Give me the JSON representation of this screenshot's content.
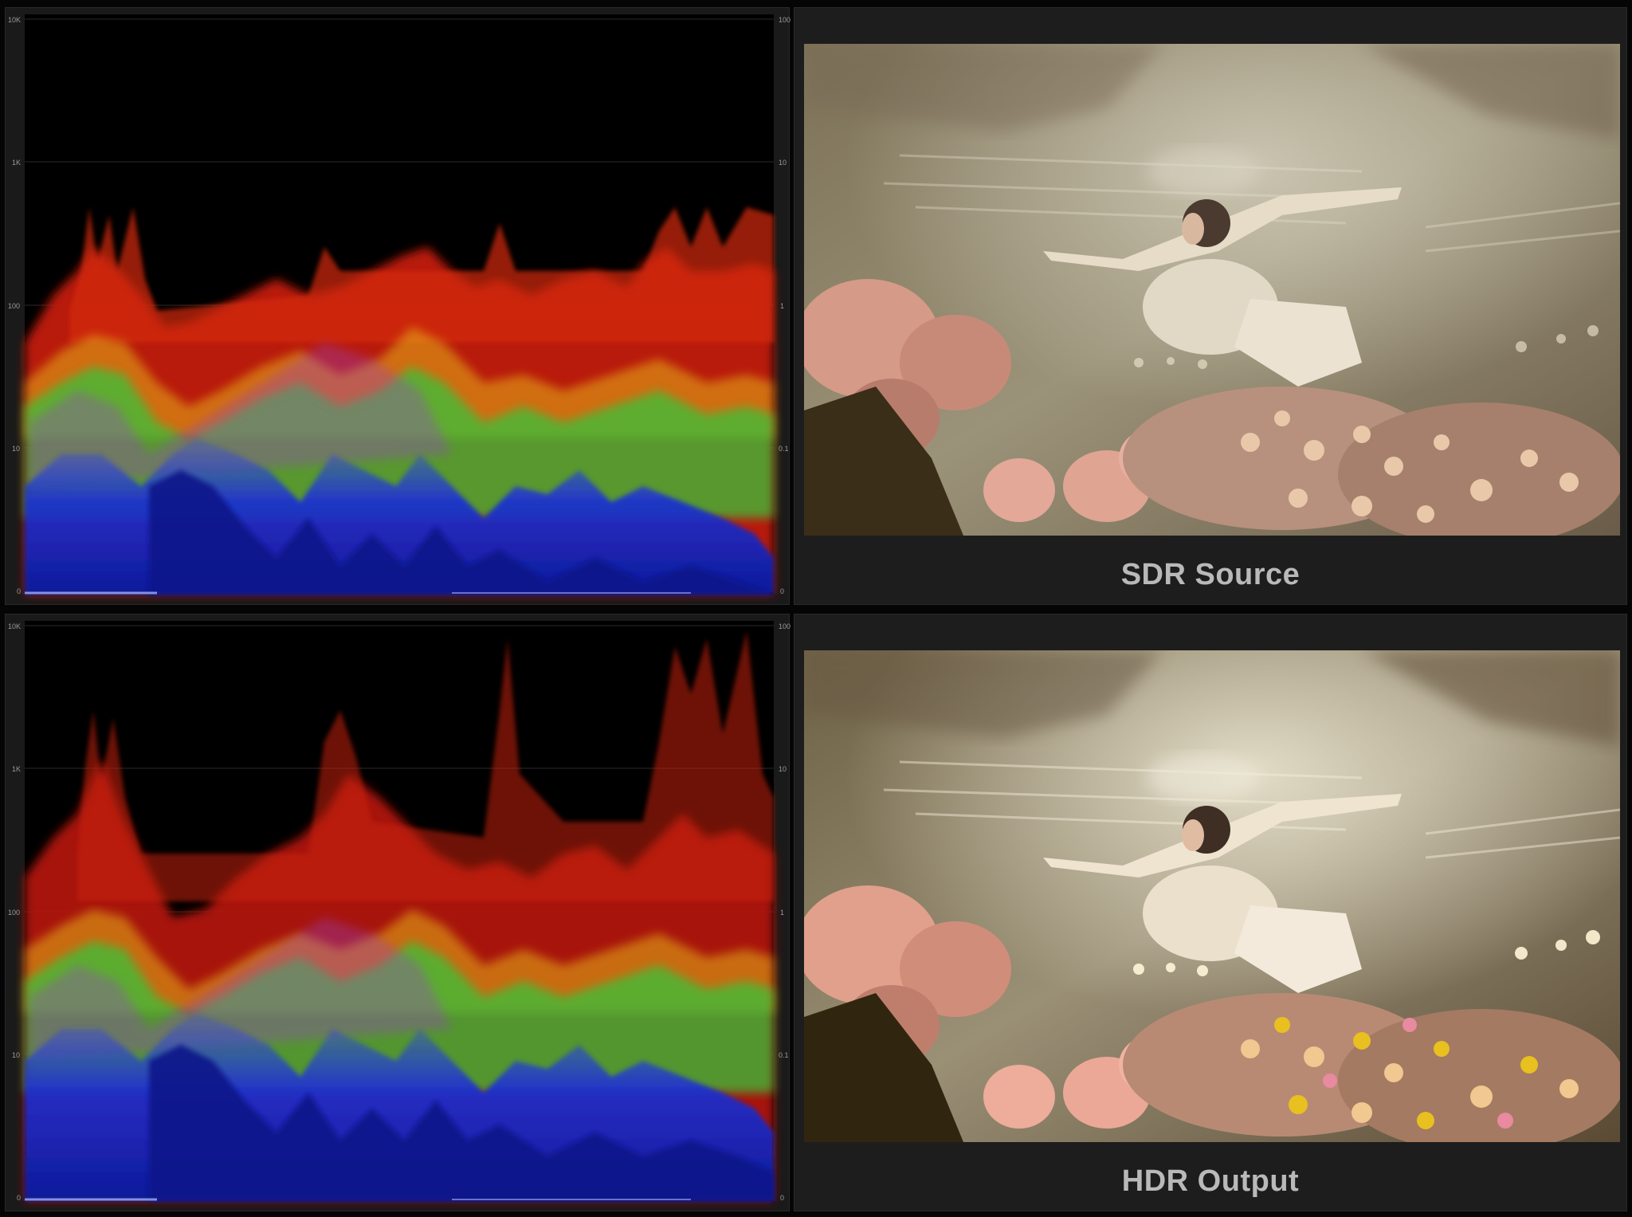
{
  "scope": {
    "left_scale": [
      "10K",
      "1K",
      "100",
      "10",
      "0"
    ],
    "right_scale": [
      "100",
      "10",
      "1",
      "0.1",
      "0"
    ],
    "colors": {
      "red": "#d42a10",
      "green": "#39c23a",
      "blue": "#1b2fd6",
      "yellow": "#d8c21a"
    }
  },
  "panels": [
    {
      "caption": "SDR Source",
      "scope_icon": "waveform-scope"
    },
    {
      "caption": "HDR Output",
      "scope_icon": "waveform-scope"
    }
  ]
}
